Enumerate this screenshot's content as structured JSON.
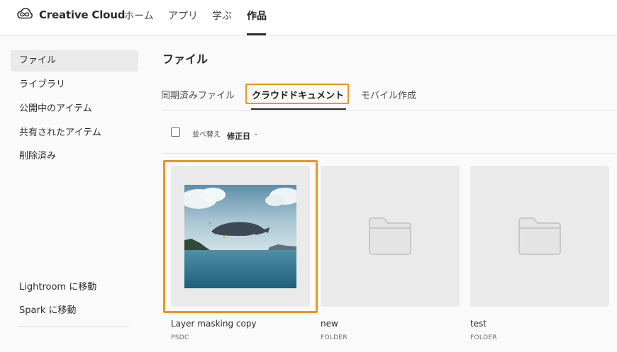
{
  "app": {
    "brand": "Creative Cloud",
    "logo_icon": "creative-cloud-logo-icon"
  },
  "nav": {
    "home": "ホーム",
    "apps": "アプリ",
    "learn": "学ぶ",
    "work": "作品",
    "active": "work"
  },
  "sidebar": {
    "items": [
      {
        "label": "ファイル",
        "active": true
      },
      {
        "label": "ライブラリ",
        "active": false
      },
      {
        "label": "公開中のアイテム",
        "active": false
      },
      {
        "label": "共有されたアイテム",
        "active": false
      },
      {
        "label": "削除済み",
        "active": false
      }
    ],
    "links": [
      {
        "label": "Lightroom に移動"
      },
      {
        "label": "Spark に移動"
      }
    ]
  },
  "main": {
    "title": "ファイル",
    "tabs": [
      {
        "label": "同期済みファイル",
        "active": false
      },
      {
        "label": "クラウドドキュメント",
        "active": true
      },
      {
        "label": "モバイル作成",
        "active": false
      }
    ],
    "sort": {
      "label": "並べ替え",
      "value": "修正日",
      "chevron": "⌄"
    },
    "items": [
      {
        "name": "Layer masking copy",
        "type": "PSDC",
        "kind": "image",
        "selected": true
      },
      {
        "name": "new",
        "type": "FOLDER",
        "kind": "folder",
        "selected": false
      },
      {
        "name": "test",
        "type": "FOLDER",
        "kind": "folder",
        "selected": false
      }
    ]
  },
  "colors": {
    "highlight": "#f0931f",
    "card_bg": "#eaeaea",
    "folder": "#c8c8c8"
  }
}
